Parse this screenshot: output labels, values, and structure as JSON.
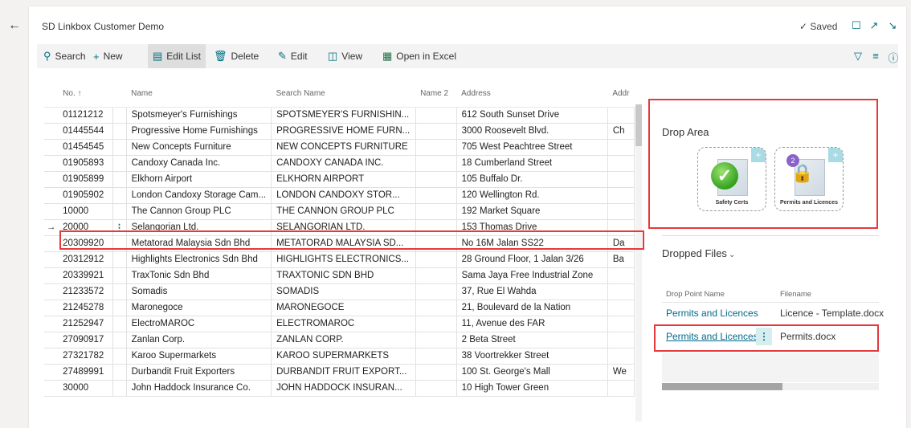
{
  "header": {
    "title": "SD Linkbox Customer Demo",
    "saved": "Saved",
    "icons": [
      "back-arrow-icon",
      "bookmark-icon",
      "open-new-window-icon",
      "collapse-icon"
    ]
  },
  "actions": {
    "search": "Search",
    "new": "New",
    "edit_list": "Edit List",
    "delete": "Delete",
    "edit": "Edit",
    "view": "View",
    "open_in_excel": "Open in Excel"
  },
  "table": {
    "columns": [
      "No. ↑",
      "Name",
      "Search Name",
      "Name 2",
      "Address",
      "Addr"
    ],
    "rows": [
      {
        "no": "01121212",
        "name": "Spotsmeyer's Furnishings",
        "search": "SPOTSMEYER'S FURNISHIN...",
        "name2": "",
        "address": "612 South Sunset Drive",
        "addr2": ""
      },
      {
        "no": "01445544",
        "name": "Progressive Home Furnishings",
        "search": "PROGRESSIVE HOME FURN...",
        "name2": "",
        "address": "3000 Roosevelt Blvd.",
        "addr2": "Ch"
      },
      {
        "no": "01454545",
        "name": "New Concepts Furniture",
        "search": "NEW CONCEPTS FURNITURE",
        "name2": "",
        "address": "705 West Peachtree Street",
        "addr2": ""
      },
      {
        "no": "01905893",
        "name": "Candoxy Canada Inc.",
        "search": "CANDOXY CANADA INC.",
        "name2": "",
        "address": "18 Cumberland Street",
        "addr2": ""
      },
      {
        "no": "01905899",
        "name": "Elkhorn Airport",
        "search": "ELKHORN AIRPORT",
        "name2": "",
        "address": "105 Buffalo Dr.",
        "addr2": ""
      },
      {
        "no": "01905902",
        "name": "London Candoxy Storage Cam...",
        "search": "LONDON CANDOXY STOR...",
        "name2": "",
        "address": "120 Wellington Rd.",
        "addr2": ""
      },
      {
        "no": "10000",
        "name": "The Cannon Group PLC",
        "search": "THE CANNON GROUP PLC",
        "name2": "",
        "address": "192 Market Square",
        "addr2": ""
      },
      {
        "no": "20000",
        "name": "Selangorian Ltd.",
        "search": "SELANGORIAN LTD.",
        "name2": "",
        "address": "153 Thomas Drive",
        "addr2": ""
      },
      {
        "no": "20309920",
        "name": "Metatorad Malaysia Sdn Bhd",
        "search": "METATORAD MALAYSIA SD...",
        "name2": "",
        "address": "No 16M Jalan SS22",
        "addr2": "Da"
      },
      {
        "no": "20312912",
        "name": "Highlights Electronics Sdn Bhd",
        "search": "HIGHLIGHTS ELECTRONICS...",
        "name2": "",
        "address": "28 Ground Floor, 1 Jalan 3/26",
        "addr2": "Ba"
      },
      {
        "no": "20339921",
        "name": "TraxTonic Sdn Bhd",
        "search": "TRAXTONIC SDN BHD",
        "name2": "",
        "address": "Sama Jaya Free Industrial Zone",
        "addr2": ""
      },
      {
        "no": "21233572",
        "name": "Somadis",
        "search": "SOMADIS",
        "name2": "",
        "address": "37, Rue El Wahda",
        "addr2": ""
      },
      {
        "no": "21245278",
        "name": "Maronegoce",
        "search": "MARONEGOCE",
        "name2": "",
        "address": "21, Boulevard de la Nation",
        "addr2": ""
      },
      {
        "no": "21252947",
        "name": "ElectroMAROC",
        "search": "ELECTROMAROC",
        "name2": "",
        "address": "11, Avenue des FAR",
        "addr2": ""
      },
      {
        "no": "27090917",
        "name": "Zanlan Corp.",
        "search": "ZANLAN CORP.",
        "name2": "",
        "address": "2 Beta Street",
        "addr2": ""
      },
      {
        "no": "27321782",
        "name": "Karoo Supermarkets",
        "search": "KAROO SUPERMARKETS",
        "name2": "",
        "address": "38 Voortrekker Street",
        "addr2": ""
      },
      {
        "no": "27489991",
        "name": "Durbandit Fruit Exporters",
        "search": "DURBANDIT FRUIT EXPORT...",
        "name2": "",
        "address": "100 St. George's Mall",
        "addr2": "We"
      },
      {
        "no": "30000",
        "name": "John Haddock Insurance Co.",
        "search": "JOHN HADDOCK INSURAN...",
        "name2": "",
        "address": "10 High Tower Green",
        "addr2": ""
      }
    ]
  },
  "drop_area": {
    "title": "Drop Area",
    "tiles": [
      {
        "label": "Safety Certs",
        "icon": "green-check-document-icon"
      },
      {
        "label": "Permits and Licences",
        "icon": "padlock-document-icon",
        "badge": "2"
      }
    ]
  },
  "dropped_files": {
    "title": "Dropped Files",
    "columns": [
      "Drop Point Name",
      "Filename"
    ],
    "rows": [
      {
        "drop_point": "Permits and Licences",
        "filename": "Licence - Template.docx"
      },
      {
        "drop_point": "Permits and Licences",
        "filename": "Permits.docx"
      }
    ]
  }
}
